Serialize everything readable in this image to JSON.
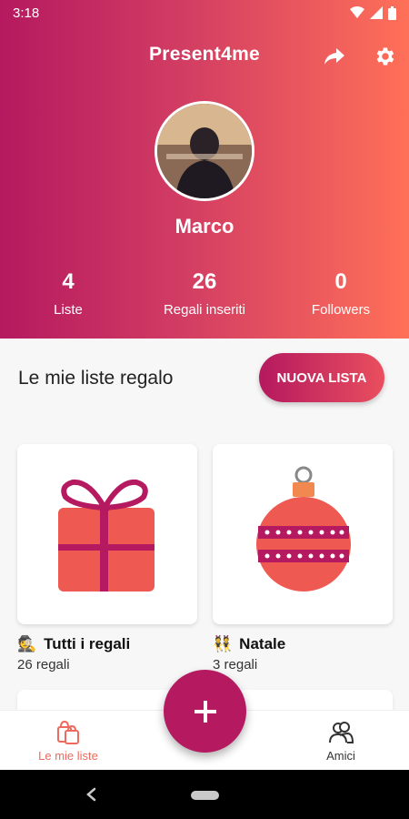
{
  "status": {
    "time": "3:18"
  },
  "header": {
    "title": "Present4me",
    "share_icon": "share-icon",
    "settings_icon": "gear-icon"
  },
  "profile": {
    "name": "Marco",
    "stats": [
      {
        "value": "4",
        "label": "Liste"
      },
      {
        "value": "26",
        "label": "Regali inseriti"
      },
      {
        "value": "0",
        "label": "Followers"
      }
    ]
  },
  "section": {
    "title": "Le mie liste regalo",
    "new_list_label": "NUOVA LISTA"
  },
  "lists": [
    {
      "emoji": "🕵️",
      "title": "Tutti i regali",
      "count": "26 regali",
      "icon": "gift-box-icon"
    },
    {
      "emoji": "👯",
      "title": "Natale",
      "count": "3 regali",
      "icon": "christmas-ornament-icon"
    }
  ],
  "bottom_nav": {
    "my_lists_label": "Le mie liste",
    "friends_label": "Amici",
    "fab_label": "+"
  },
  "colors": {
    "primary": "#b5195f",
    "accent": "#ff7058",
    "active_nav": "#ee6a5e",
    "gift": "#ee5a52"
  }
}
